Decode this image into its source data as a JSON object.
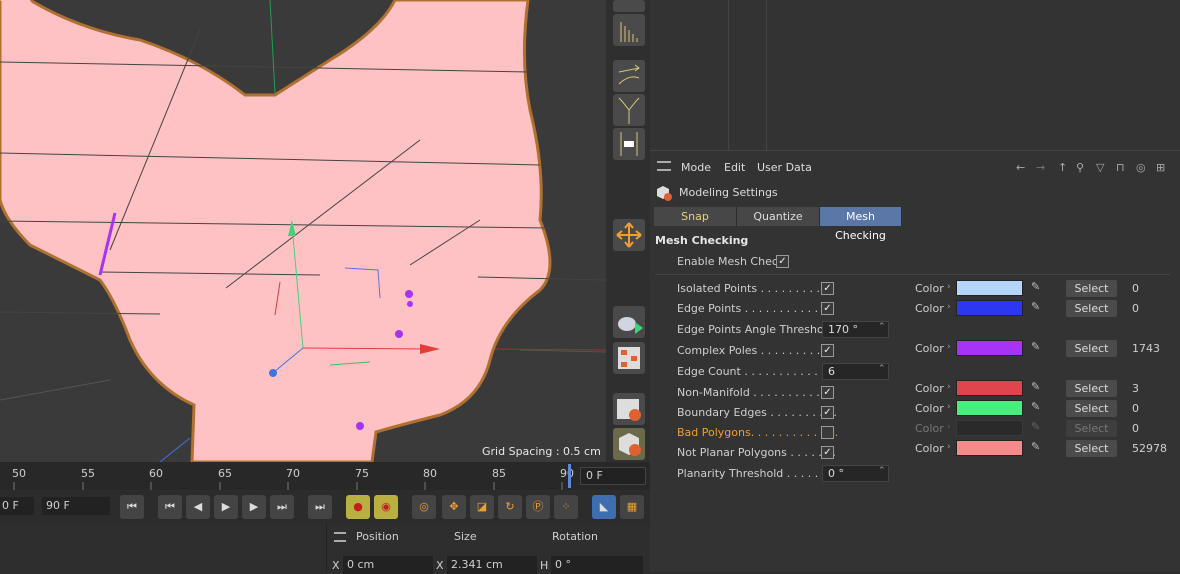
{
  "viewport": {
    "grid_spacing": "Grid Spacing : 0.5 cm"
  },
  "timeline": {
    "ticks": [
      "50",
      "55",
      "60",
      "65",
      "70",
      "75",
      "80",
      "85",
      "90"
    ],
    "current_frame": "0 F"
  },
  "transport": {
    "start_field": "0 F",
    "end_field": "90 F"
  },
  "coords": {
    "position_label": "Position",
    "size_label": "Size",
    "rotation_label": "Rotation",
    "x_label": "X",
    "x_value": "0 cm",
    "sx_label": "X",
    "sx_value": "2.341 cm",
    "h_label": "H",
    "h_value": "0 °"
  },
  "attributes": {
    "menu": [
      "Mode",
      "Edit",
      "User Data"
    ],
    "title": "Modeling Settings",
    "tabs": [
      "Snap",
      "Quantize",
      "Mesh Checking"
    ],
    "section": "Mesh Checking",
    "enable_label": "Enable Mesh Check",
    "enable_checked": true,
    "rows": [
      {
        "label": "Isolated Points . . . . . . . . . . .",
        "checked": true,
        "color": "#b5d6f8",
        "count": "0",
        "select": "Select",
        "color_label": "Color"
      },
      {
        "label": "Edge Points . . . . . . . . . . . . .",
        "checked": true,
        "color": "#2d36f0",
        "count": "0",
        "select": "Select",
        "color_label": "Color"
      },
      {
        "label": "Edge Points Angle Threshold",
        "value": "170 °"
      },
      {
        "label": "Complex Poles . . . . . . . . . . .",
        "checked": true,
        "color": "#a633f5",
        "count": "1743",
        "select": "Select",
        "color_label": "Color"
      },
      {
        "label": "Edge Count . . . . . . . . . . . . .",
        "value": "6"
      },
      {
        "label": "Non-Manifold . . . . . . . . . . . .",
        "checked": true,
        "color": "#e0444c",
        "count": "3",
        "select": "Select",
        "color_label": "Color"
      },
      {
        "label": "Boundary Edges . . . . . . . . . .",
        "checked": true,
        "color": "#47ef7e",
        "count": "0",
        "select": "Select",
        "color_label": "Color"
      },
      {
        "label": "Bad Polygons. . . . . . . . . . . . .",
        "checked": false,
        "color": "#2a2a2a",
        "count": "0",
        "select": "Select",
        "color_label": "Color"
      },
      {
        "label": "Not Planar Polygons . . . . . . .",
        "checked": true,
        "color": "#f48a8a",
        "count": "52978",
        "select": "Select",
        "color_label": "Color"
      },
      {
        "label": "Planarity Threshold . . . . . . . .",
        "value": "0 °"
      }
    ]
  }
}
